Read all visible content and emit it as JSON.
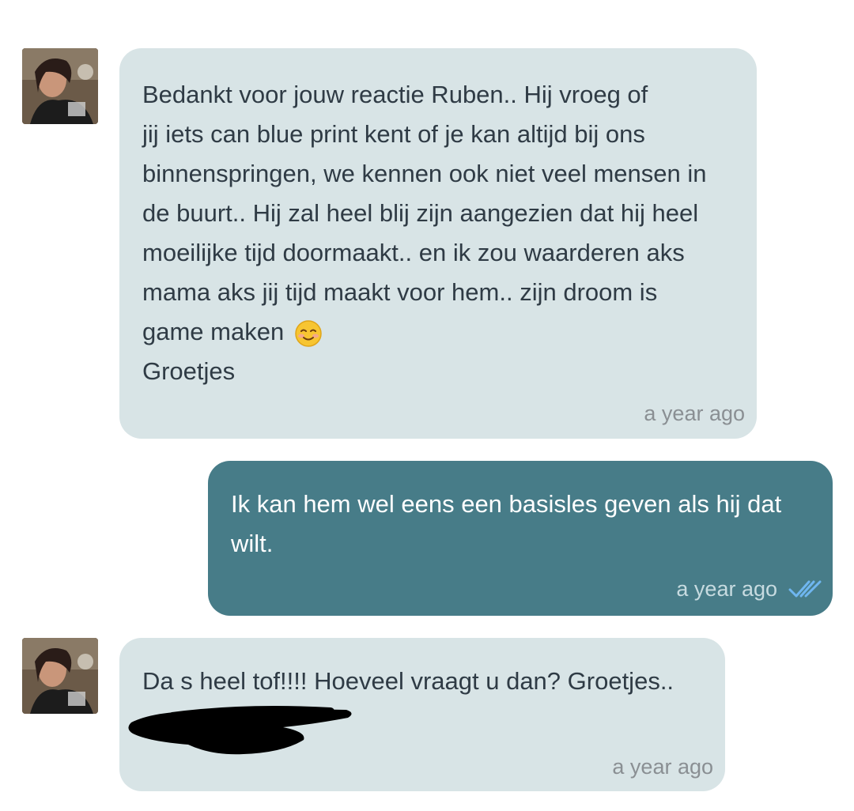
{
  "messages": [
    {
      "direction": "incoming",
      "text": "Bedankt voor jouw reactie Ruben.. Hij vroeg of\njij iets can blue print kent of je kan altijd bij ons\nbinnenspringen, we kennen ook niet veel mensen in\nde buurt.. Hij zal heel blij zijn aangezien dat hij heel\nmoeilijke tijd doormaakt.. en ik zou waarderen aks\nmama aks jij tijd maakt voor hem.. zijn droom is\ngame maken",
      "emoji": "smiling-face-icon",
      "text_after": "Groetjes",
      "time": "a year ago"
    },
    {
      "direction": "outgoing",
      "text": "Ik kan hem wel eens een basisles geven als hij dat\nwilt.",
      "time": "a year ago",
      "status_icon": "double-check-icon"
    },
    {
      "direction": "incoming",
      "text": "Da s heel tof!!!! Hoeveel vraagt u dan? Groetjes..",
      "time": "a year ago"
    }
  ],
  "colors": {
    "incoming_bubble": "#d8e4e6",
    "outgoing_bubble": "#477c88",
    "read_ticks": "#6fb6f0",
    "redaction": "#000000"
  }
}
